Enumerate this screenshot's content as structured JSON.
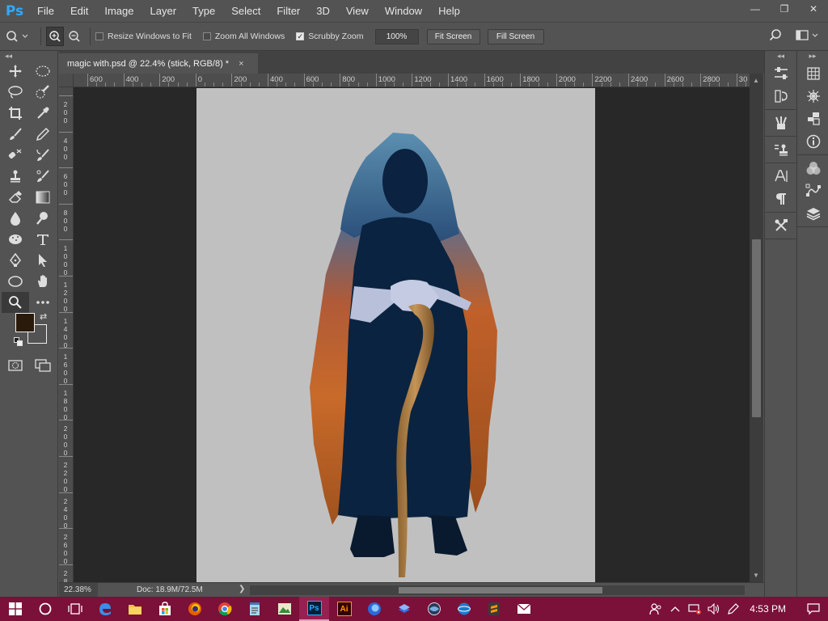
{
  "app": {
    "logo": "Ps",
    "menu": [
      "File",
      "Edit",
      "Image",
      "Layer",
      "Type",
      "Select",
      "Filter",
      "3D",
      "View",
      "Window",
      "Help"
    ],
    "window_controls": [
      "—",
      "❐",
      "✕"
    ]
  },
  "options_bar": {
    "resize_windows": "Resize Windows to Fit",
    "zoom_all": "Zoom All Windows",
    "scrubby": "Scrubby Zoom",
    "scrubby_checked": true,
    "zoom_value": "100%",
    "fit_screen": "Fit Screen",
    "fill_screen": "Fill Screen"
  },
  "document": {
    "tab_title": "magic with.psd @ 22.4% (stick, RGB/8) *",
    "close": "×"
  },
  "ruler_h": {
    "labels": [
      "600",
      "400",
      "200",
      "0",
      "200",
      "400",
      "600",
      "800",
      "1000",
      "1200",
      "1400",
      "1600",
      "1800",
      "2000",
      "2200",
      "2400",
      "2600",
      "2800",
      "30"
    ]
  },
  "ruler_v": {
    "labels": [
      "2\n0\n0",
      "4\n0\n0",
      "6\n0\n0",
      "8\n0\n0",
      "1\n0\n0\n0",
      "1\n2\n0\n0",
      "1\n4\n0\n0",
      "1\n6\n0\n0",
      "1\n8\n0\n0",
      "2\n0\n0\n0",
      "2\n2\n0\n0",
      "2\n4\n0\n0",
      "2\n6\n0\n0",
      "2\n8\n0\n0"
    ]
  },
  "status": {
    "zoom": "22.38%",
    "doc": "Doc: 18.9M/72.5M",
    "arrow": "❯"
  },
  "colors": {
    "foreground": "#2a1a0c",
    "background": "#535353",
    "accent": "#31a8ff",
    "taskbar": "#7b1038"
  },
  "taskbar": {
    "ps_label": "Ps",
    "ai_label": "Ai",
    "time": "4:53 PM"
  }
}
